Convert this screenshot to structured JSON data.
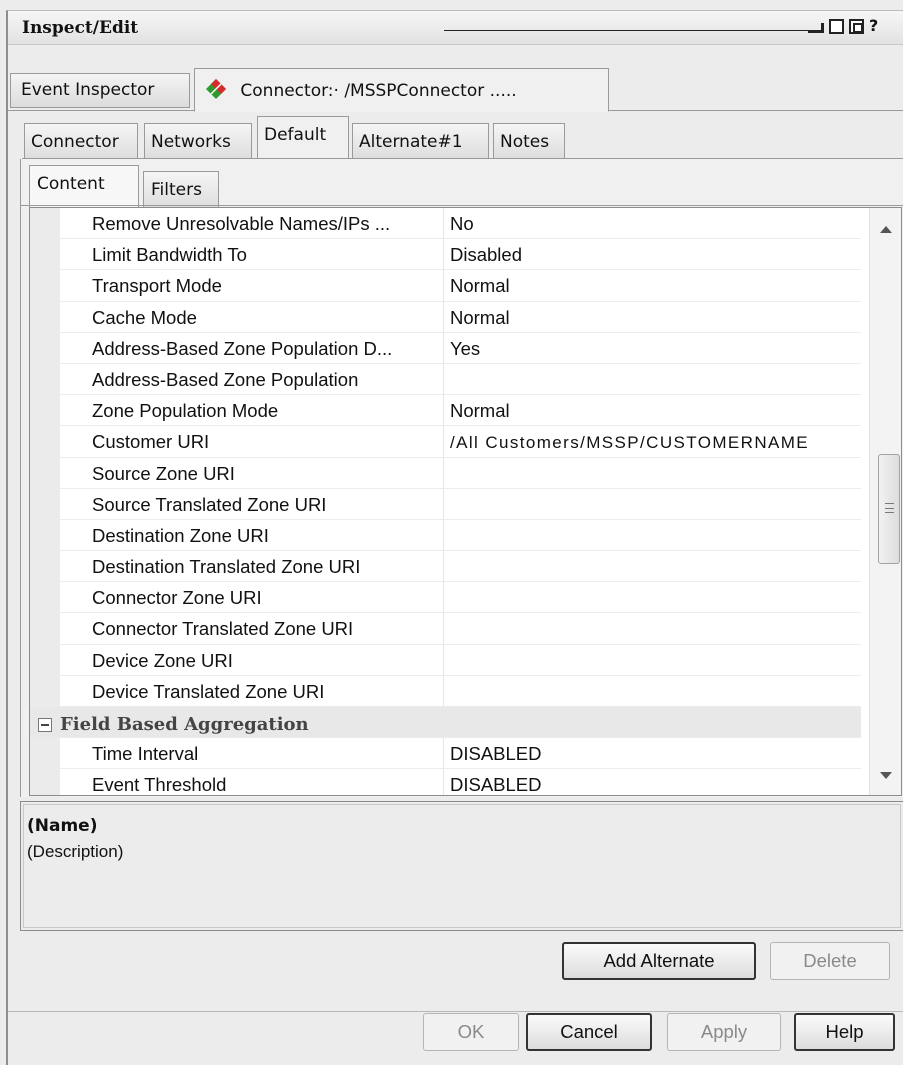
{
  "window": {
    "title": "Inspect/Edit",
    "controls": [
      "minimize-icon",
      "restore-icon",
      "maximize-icon",
      "help-icon"
    ],
    "help_glyph": "?"
  },
  "outer_tabs": [
    {
      "label": "Event Inspector",
      "active": false
    },
    {
      "label": "Connector:· /MSSPConnector .....",
      "active": true,
      "icon": "connector-logo-icon"
    }
  ],
  "inner_tabs": [
    {
      "label": "Connector",
      "active": false
    },
    {
      "label": "Networks",
      "active": false
    },
    {
      "label": "Default",
      "active": true
    },
    {
      "label": "Alternate#1",
      "active": false
    },
    {
      "label": "Notes",
      "active": false
    }
  ],
  "content_tabs": [
    {
      "label": "Content",
      "active": true
    },
    {
      "label": "Filters",
      "active": false
    }
  ],
  "properties": [
    {
      "name": "Remove Unresolvable Names/IPs ...",
      "value": "No"
    },
    {
      "name": "Limit Bandwidth To",
      "value": "Disabled"
    },
    {
      "name": "Transport Mode",
      "value": "Normal"
    },
    {
      "name": "Cache Mode",
      "value": "Normal"
    },
    {
      "name": "Address-Based Zone Population D...",
      "value": "Yes"
    },
    {
      "name": "Address-Based Zone Population",
      "value": ""
    },
    {
      "name": "Zone Population Mode",
      "value": "Normal"
    },
    {
      "name": "Customer URI",
      "value": "/All Customers/MSSP/CUSTOMERNAME"
    },
    {
      "name": "Source Zone URI",
      "value": ""
    },
    {
      "name": "Source Translated Zone URI",
      "value": ""
    },
    {
      "name": "Destination Zone URI",
      "value": ""
    },
    {
      "name": "Destination Translated Zone URI",
      "value": ""
    },
    {
      "name": "Connector Zone URI",
      "value": ""
    },
    {
      "name": "Connector Translated Zone URI",
      "value": ""
    },
    {
      "name": "Device Zone URI",
      "value": ""
    },
    {
      "name": "Device Translated Zone URI",
      "value": ""
    }
  ],
  "category": {
    "label": "Field Based Aggregation",
    "expanded": true
  },
  "category_properties": [
    {
      "name": "Time Interval",
      "value": "DISABLED"
    },
    {
      "name": "Event Threshold",
      "value": "DISABLED"
    }
  ],
  "description": {
    "name": "(Name)",
    "text": "(Description)"
  },
  "buttons": {
    "add_alternate": "Add Alternate",
    "delete": "Delete",
    "ok": "OK",
    "cancel": "Cancel",
    "apply": "Apply",
    "help": "Help"
  }
}
